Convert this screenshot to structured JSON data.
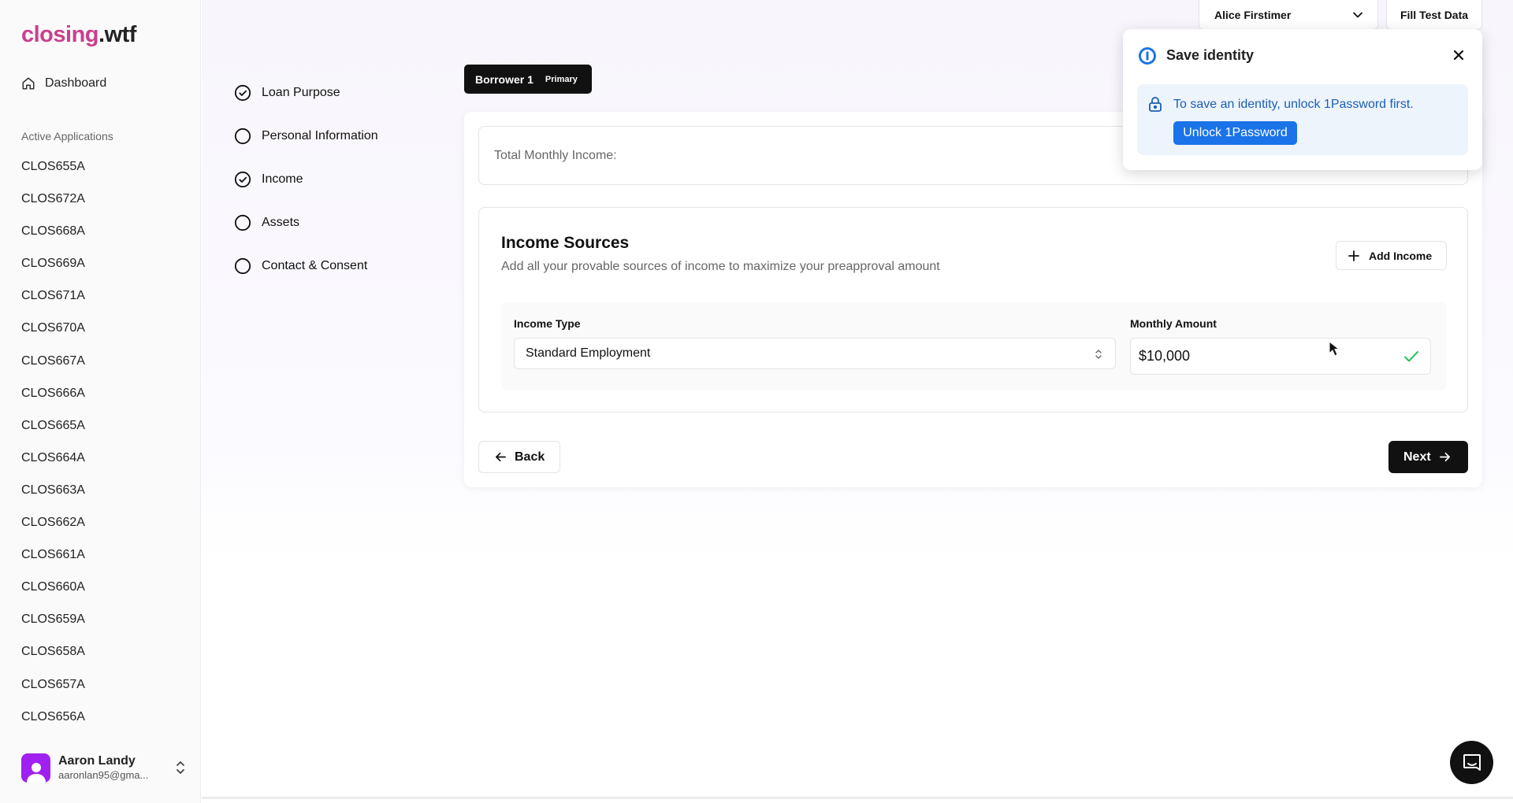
{
  "logo": {
    "part1": "closing",
    "part2": ".wtf"
  },
  "sidebar": {
    "dashboard_label": "Dashboard",
    "section_label": "Active Applications",
    "applications": [
      "CLOS655A",
      "CLOS672A",
      "CLOS668A",
      "CLOS669A",
      "CLOS671A",
      "CLOS670A",
      "CLOS667A",
      "CLOS666A",
      "CLOS665A",
      "CLOS664A",
      "CLOS663A",
      "CLOS662A",
      "CLOS661A",
      "CLOS660A",
      "CLOS659A",
      "CLOS658A",
      "CLOS657A",
      "CLOS656A"
    ],
    "user": {
      "name": "Aaron Landy",
      "email": "aaronlan95@gma..."
    }
  },
  "steps": [
    {
      "label": "Loan Purpose",
      "status": "complete"
    },
    {
      "label": "Personal Information",
      "status": "incomplete"
    },
    {
      "label": "Income",
      "status": "complete"
    },
    {
      "label": "Assets",
      "status": "incomplete"
    },
    {
      "label": "Contact & Consent",
      "status": "incomplete"
    }
  ],
  "borrower_tab": {
    "label": "Borrower 1",
    "badge": "Primary"
  },
  "total": {
    "label": "Total Monthly Income:"
  },
  "income_sources": {
    "title": "Income Sources",
    "subtitle": "Add all your provable sources of income to maximize your preapproval amount",
    "add_label": "Add Income",
    "type_label": "Income Type",
    "type_value": "Standard Employment",
    "amount_label": "Monthly Amount",
    "amount_value": "$10,000"
  },
  "nav": {
    "back_label": "Back",
    "next_label": "Next"
  },
  "topbar": {
    "user_select": "Alice Firstimer",
    "fill_label": "Fill Test Data"
  },
  "popup": {
    "title": "Save identity",
    "message": "To save an identity, unlock 1Password first.",
    "unlock_label": "Unlock 1Password"
  },
  "colors": {
    "brand_pink": "#c9408e",
    "onepassword_blue": "#1a73e8",
    "check_green": "#22c55e",
    "avatar_purple": "#a020f0"
  }
}
